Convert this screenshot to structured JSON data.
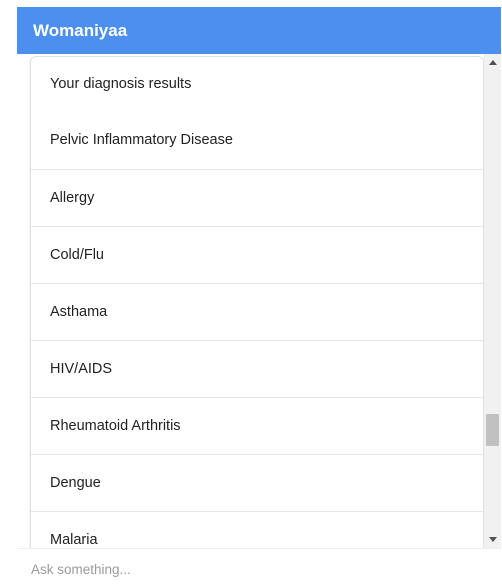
{
  "app": {
    "title": "Womaniyaa",
    "accent_color": "#4d8fef"
  },
  "results": {
    "title": "Your diagnosis results",
    "items": [
      "Pelvic Inflammatory Disease",
      "Allergy",
      "Cold/Flu",
      "Asthama",
      "HIV/AIDS",
      "Rheumatoid Arthritis",
      "Dengue",
      "Malaria"
    ]
  },
  "chat_input": {
    "placeholder": "Ask something...",
    "value": ""
  },
  "icons": {
    "scroll_up": "triangle-up-icon",
    "scroll_down": "triangle-down-icon"
  }
}
